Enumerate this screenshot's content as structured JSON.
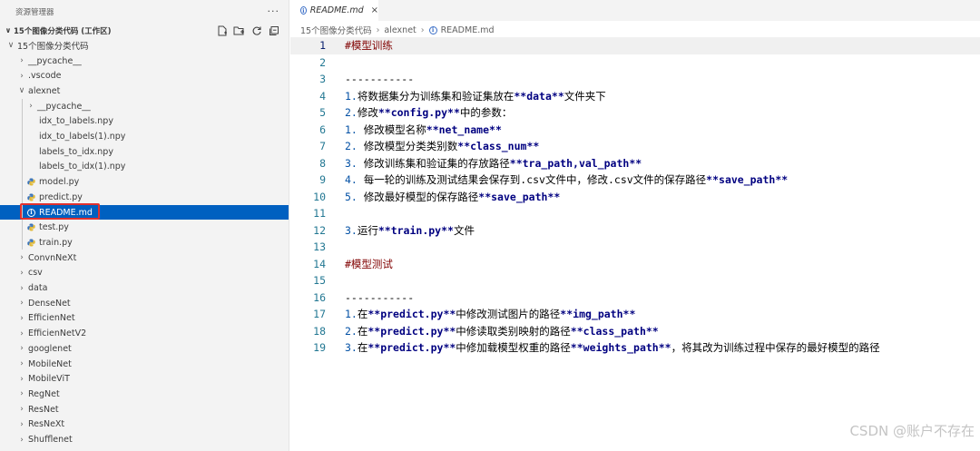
{
  "sidebar": {
    "title": "资源管理器",
    "more": "···",
    "workspace": "15个图像分类代码 (工作区)",
    "tree": [
      {
        "label": "15个图像分类代码",
        "kind": "folder-open",
        "depth": 0
      },
      {
        "label": "__pycache__",
        "kind": "folder",
        "depth": 1
      },
      {
        "label": ".vscode",
        "kind": "folder",
        "depth": 1
      },
      {
        "label": "alexnet",
        "kind": "folder-open",
        "depth": 1
      },
      {
        "label": "__pycache__",
        "kind": "folder",
        "depth": 2
      },
      {
        "label": "idx_to_labels.npy",
        "kind": "file",
        "depth": 2
      },
      {
        "label": "idx_to_labels(1).npy",
        "kind": "file",
        "depth": 2
      },
      {
        "label": "labels_to_idx.npy",
        "kind": "file",
        "depth": 2
      },
      {
        "label": "labels_to_idx(1).npy",
        "kind": "file",
        "depth": 2
      },
      {
        "label": "model.py",
        "kind": "python",
        "depth": 2
      },
      {
        "label": "predict.py",
        "kind": "python",
        "depth": 2
      },
      {
        "label": "README.md",
        "kind": "info",
        "depth": 2,
        "selected": true
      },
      {
        "label": "test.py",
        "kind": "python",
        "depth": 2
      },
      {
        "label": "train.py",
        "kind": "python",
        "depth": 2
      },
      {
        "label": "ConvnNeXt",
        "kind": "folder",
        "depth": 1
      },
      {
        "label": "csv",
        "kind": "folder",
        "depth": 1
      },
      {
        "label": "data",
        "kind": "folder",
        "depth": 1
      },
      {
        "label": "DenseNet",
        "kind": "folder",
        "depth": 1
      },
      {
        "label": "EfficienNet",
        "kind": "folder",
        "depth": 1
      },
      {
        "label": "EfficienNetV2",
        "kind": "folder",
        "depth": 1
      },
      {
        "label": "googlenet",
        "kind": "folder",
        "depth": 1
      },
      {
        "label": "MobileNet",
        "kind": "folder",
        "depth": 1
      },
      {
        "label": "MobileViT",
        "kind": "folder",
        "depth": 1
      },
      {
        "label": "RegNet",
        "kind": "folder",
        "depth": 1
      },
      {
        "label": "ResNet",
        "kind": "folder",
        "depth": 1
      },
      {
        "label": "ResNeXt",
        "kind": "folder",
        "depth": 1
      },
      {
        "label": "Shufflenet",
        "kind": "folder",
        "depth": 1
      }
    ]
  },
  "editor": {
    "tab": {
      "label": "README.md",
      "close": "×"
    },
    "breadcrumb": [
      "15个图像分类代码",
      "alexnet",
      "README.md"
    ],
    "lines": [
      [
        {
          "t": "#模型训练",
          "s": "h"
        }
      ],
      [],
      [
        {
          "t": "-----------",
          "s": ""
        }
      ],
      [
        {
          "t": "1.",
          "s": "list"
        },
        {
          "t": "将数据集分为训练集和验证集放在",
          "s": ""
        },
        {
          "t": "**data**",
          "s": "b"
        },
        {
          "t": "文件夹下",
          "s": ""
        }
      ],
      [
        {
          "t": "2.",
          "s": "list"
        },
        {
          "t": "修改",
          "s": ""
        },
        {
          "t": "**config.py**",
          "s": "b"
        },
        {
          "t": "中的参数：",
          "s": ""
        }
      ],
      [
        {
          "t": "1. ",
          "s": "list"
        },
        {
          "t": "修改模型名称",
          "s": ""
        },
        {
          "t": "**net_name**",
          "s": "b"
        }
      ],
      [
        {
          "t": "2. ",
          "s": "list"
        },
        {
          "t": "修改模型分类类别数",
          "s": ""
        },
        {
          "t": "**class_num**",
          "s": "b"
        }
      ],
      [
        {
          "t": "3. ",
          "s": "list"
        },
        {
          "t": "修改训练集和验证集的存放路径",
          "s": ""
        },
        {
          "t": "**tra_path,val_path**",
          "s": "b"
        }
      ],
      [
        {
          "t": "4. ",
          "s": "list"
        },
        {
          "t": "每一轮的训练及测试结果会保存到.csv文件中，修改.csv文件的保存路径",
          "s": ""
        },
        {
          "t": "**save_path**",
          "s": "b"
        }
      ],
      [
        {
          "t": "5. ",
          "s": "list"
        },
        {
          "t": "修改最好模型的保存路径",
          "s": ""
        },
        {
          "t": "**save_path**",
          "s": "b"
        }
      ],
      [],
      [
        {
          "t": "3.",
          "s": "list"
        },
        {
          "t": "运行",
          "s": ""
        },
        {
          "t": "**train.py**",
          "s": "b"
        },
        {
          "t": "文件",
          "s": ""
        }
      ],
      [],
      [
        {
          "t": "#模型测试",
          "s": "h"
        }
      ],
      [],
      [
        {
          "t": "-----------",
          "s": ""
        }
      ],
      [
        {
          "t": "1.",
          "s": "list"
        },
        {
          "t": "在",
          "s": ""
        },
        {
          "t": "**predict.py**",
          "s": "b"
        },
        {
          "t": "中修改测试图片的路径",
          "s": ""
        },
        {
          "t": "**img_path**",
          "s": "b"
        }
      ],
      [
        {
          "t": "2.",
          "s": "list"
        },
        {
          "t": "在",
          "s": ""
        },
        {
          "t": "**predict.py**",
          "s": "b"
        },
        {
          "t": "中修读取类别映射的路径",
          "s": ""
        },
        {
          "t": "**class_path**",
          "s": "b"
        }
      ],
      [
        {
          "t": "3.",
          "s": "list"
        },
        {
          "t": "在",
          "s": ""
        },
        {
          "t": "**predict.py**",
          "s": "b"
        },
        {
          "t": "中修加载模型权重的路径",
          "s": ""
        },
        {
          "t": "**weights_path**",
          "s": "b"
        },
        {
          "t": "，将其改为训练过程中保存的最好模型的路径",
          "s": ""
        }
      ]
    ],
    "indent": [
      0,
      0,
      0,
      0,
      0,
      1,
      1,
      1,
      1,
      1,
      0,
      0,
      0,
      0,
      0,
      0,
      0,
      0,
      0
    ]
  },
  "watermark": "CSDN @账户不存在"
}
